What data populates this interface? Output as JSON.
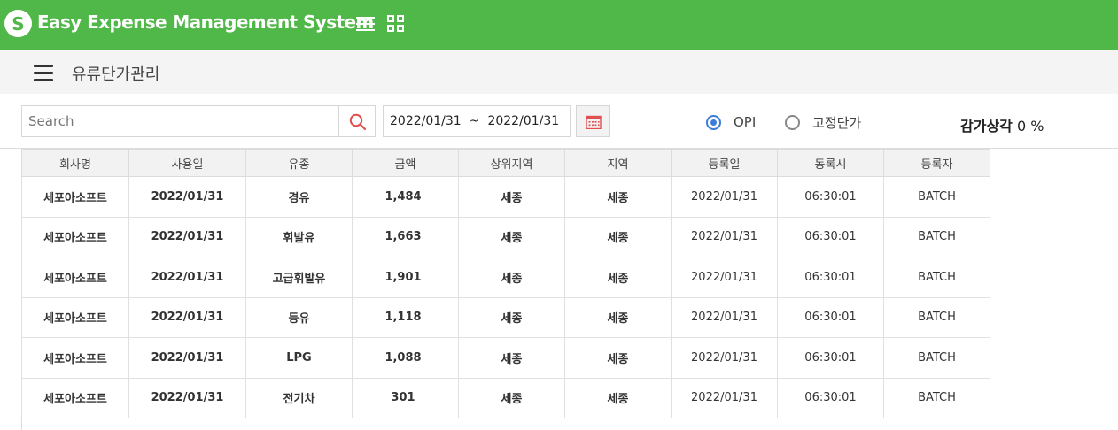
{
  "app": {
    "logo_letter": "S",
    "title": "Easy Expense Management System"
  },
  "page": {
    "title": "유류단가관리"
  },
  "search": {
    "placeholder": "Search",
    "value": ""
  },
  "date_range": {
    "start": "2022/01/31",
    "separator": "~",
    "end": "2022/01/31"
  },
  "price_type": {
    "options": [
      {
        "label": "OPI",
        "checked": true
      },
      {
        "label": "고정단가",
        "checked": false
      }
    ]
  },
  "depreciation": {
    "label": "감가상각",
    "value": "0",
    "unit": "%"
  },
  "colors": {
    "header_green": "#50b848",
    "link_blue": "#2f6fd6",
    "amount_red": "#e84545",
    "radio_blue": "#3b7dd8"
  },
  "table": {
    "columns": [
      "회사명",
      "사용일",
      "유종",
      "금액",
      "상위지역",
      "지역",
      "등록일",
      "동록시",
      "등록자"
    ],
    "rows": [
      [
        "세포아소프트",
        "2022/01/31",
        "경유",
        "1,484",
        "세종",
        "세종",
        "2022/01/31",
        "06:30:01",
        "BATCH"
      ],
      [
        "세포아소프트",
        "2022/01/31",
        "휘발유",
        "1,663",
        "세종",
        "세종",
        "2022/01/31",
        "06:30:01",
        "BATCH"
      ],
      [
        "세포아소프트",
        "2022/01/31",
        "고급휘발유",
        "1,901",
        "세종",
        "세종",
        "2022/01/31",
        "06:30:01",
        "BATCH"
      ],
      [
        "세포아소프트",
        "2022/01/31",
        "등유",
        "1,118",
        "세종",
        "세종",
        "2022/01/31",
        "06:30:01",
        "BATCH"
      ],
      [
        "세포아소프트",
        "2022/01/31",
        "LPG",
        "1,088",
        "세종",
        "세종",
        "2022/01/31",
        "06:30:01",
        "BATCH"
      ],
      [
        "세포아소프트",
        "2022/01/31",
        "전기차",
        "301",
        "세종",
        "세종",
        "2022/01/31",
        "06:30:01",
        "BATCH"
      ]
    ]
  }
}
